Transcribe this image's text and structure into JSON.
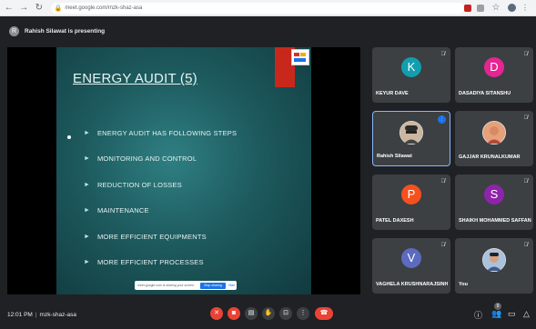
{
  "browser": {
    "back_icon": "back-arrow-icon",
    "forward_icon": "forward-arrow-icon",
    "reload_icon": "reload-icon",
    "url": "meet.google.com/mzk-shaz-asa"
  },
  "presenting": {
    "text": "Rahish Silawat is presenting"
  },
  "slide": {
    "title": "ENERGY AUDIT (5)",
    "bullets": [
      "ENERGY AUDIT HAS FOLLOWING STEPS",
      "MONITORING AND CONTROL",
      "REDUCTION OF LOSSES",
      "MAINTENANCE",
      "MORE EFFICIENT EQUIPMENTS",
      "MORE EFFICIENT PROCESSES"
    ]
  },
  "share_banner": {
    "text": "meet.google.com is sharing your screen.",
    "stop_label": "Stop sharing",
    "hide_label": "Hide"
  },
  "participants": [
    {
      "name": "KEYUR DAVE",
      "initial": "K",
      "color": "#129eaf"
    },
    {
      "name": "DASADIYA SITANSHU",
      "initial": "D",
      "color": "#e52592"
    },
    {
      "name": "Rahish Silawat",
      "initial": "",
      "color": "#6b5a4a"
    },
    {
      "name": "GAJJAR KRUNALKUMAR",
      "initial": "",
      "color": "#c9825f"
    },
    {
      "name": "PATEL DAXESH",
      "initial": "P",
      "color": "#f4511e"
    },
    {
      "name": "SHAIKH MOHAMMED SAFFAN ...",
      "initial": "S",
      "color": "#8e24aa"
    },
    {
      "name": "VAGHELA KRUSHNARAJSINH",
      "initial": "V",
      "color": "#5c6bc0"
    },
    {
      "name": "You",
      "initial": "",
      "color": "#7b9cc4"
    }
  ],
  "bottom": {
    "time": "12:01 PM",
    "separator": "|",
    "meeting_code": "mzk-shaz-asa",
    "people_count": "9"
  }
}
